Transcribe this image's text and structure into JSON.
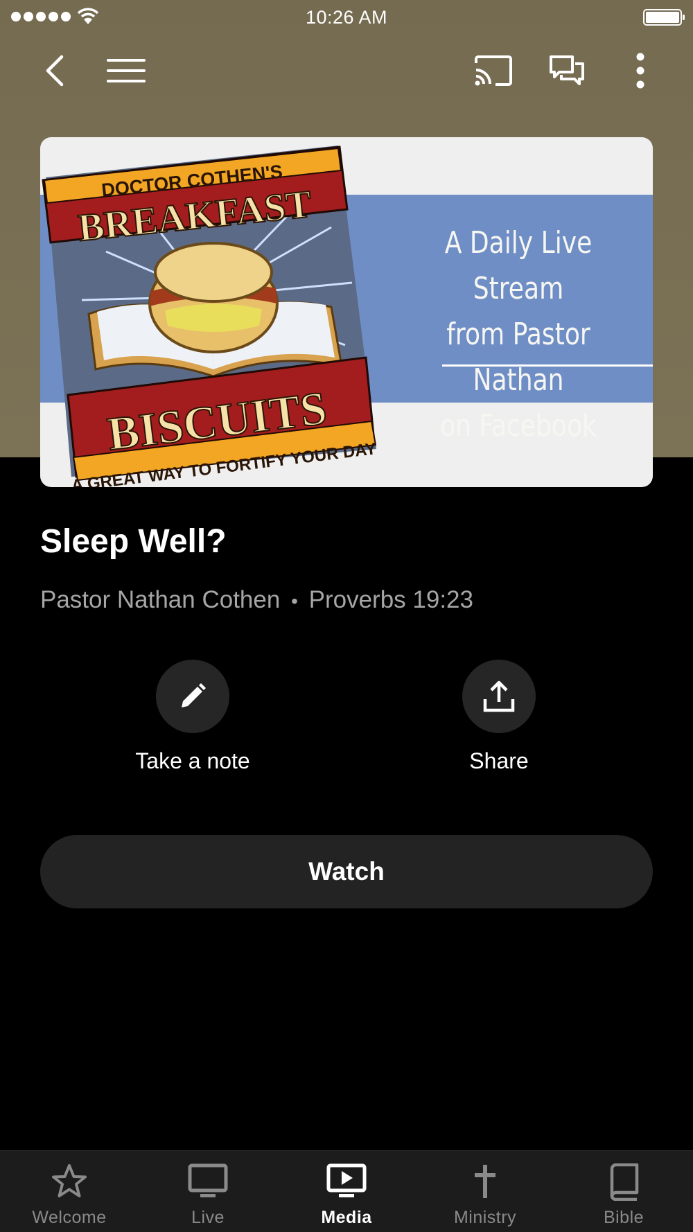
{
  "status_bar": {
    "time": "10:26 AM"
  },
  "header": {
    "icons": [
      "back-icon",
      "menu-icon",
      "cast-icon",
      "chat-icon",
      "more-icon"
    ]
  },
  "banner": {
    "logo_top": "DOCTOR COTHEN'S",
    "logo_word1": "BREAKFAST",
    "logo_word2": "BISCUITS",
    "logo_tagline": "A GREAT WAY TO FORTIFY YOUR DAY",
    "line1": "A Daily Live Stream",
    "line2": "from Pastor Nathan",
    "line3": "on Facebook"
  },
  "media": {
    "title": "Sleep Well?",
    "speaker": "Pastor Nathan Cothen",
    "separator": "•",
    "reference": "Proverbs 19:23"
  },
  "actions": {
    "note_label": "Take a note",
    "share_label": "Share",
    "watch_label": "Watch"
  },
  "tabs": [
    {
      "label": "Welcome",
      "icon": "star-icon",
      "active": false
    },
    {
      "label": "Live",
      "icon": "monitor-icon",
      "active": false
    },
    {
      "label": "Media",
      "icon": "play-monitor-icon",
      "active": true
    },
    {
      "label": "Ministry",
      "icon": "cross-icon",
      "active": false
    },
    {
      "label": "Bible",
      "icon": "book-icon",
      "active": false
    }
  ],
  "colors": {
    "header_bg": "#786e53",
    "banner_band": "#6f8ec5",
    "logo_red": "#a31d1e",
    "logo_gold": "#f2a623",
    "button_bg": "#232323",
    "tabbar_bg": "#1c1c1c"
  }
}
